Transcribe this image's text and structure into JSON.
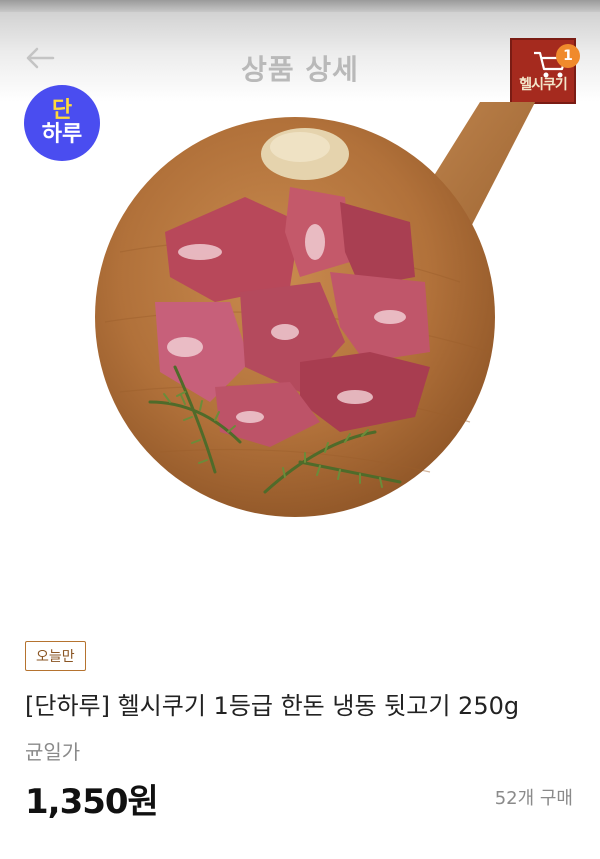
{
  "header": {
    "title": "상품 상세",
    "back_icon": "arrow-left-icon",
    "cart": {
      "logo_text": "헬시쿠기",
      "badge_count": "1",
      "icon": "shopping-cart-icon"
    }
  },
  "product_image": {
    "brand_badge": {
      "top": "단",
      "bottom": "하루"
    }
  },
  "product": {
    "badge": "오늘만",
    "name": "[단하루] 헬시쿠기 1등급 한돈 냉동 뒷고기 250g",
    "price_label": "균일가",
    "price": "1,350원",
    "purchase_count": "52개 구매"
  },
  "colors": {
    "brand_badge_bg": "#4a4df0",
    "cart_badge": "#f08a2c",
    "today_badge_border": "#b5732f"
  }
}
